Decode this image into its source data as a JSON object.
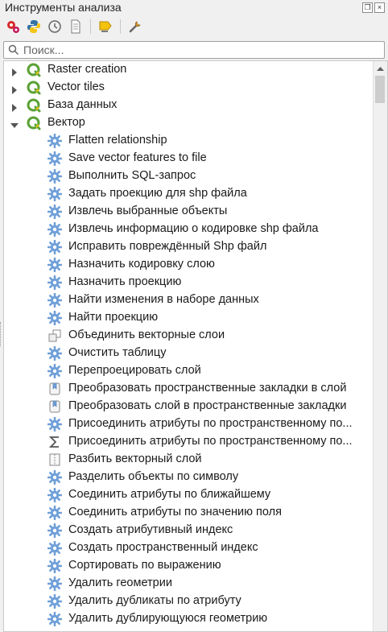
{
  "panel": {
    "title": "Инструменты анализа"
  },
  "toolbar": {
    "buttons": [
      {
        "icon": "models-gear-icon"
      },
      {
        "icon": "python-icon"
      },
      {
        "icon": "history-clock-icon"
      },
      {
        "icon": "results-document-icon"
      },
      {
        "icon": "edit-features-icon"
      },
      {
        "icon": "options-wrench-icon"
      }
    ]
  },
  "search": {
    "placeholder": "Поиск..."
  },
  "tree": {
    "groups": [
      {
        "label": "Raster creation",
        "expanded": false
      },
      {
        "label": "Vector tiles",
        "expanded": false
      },
      {
        "label": "База данных",
        "expanded": false
      },
      {
        "label": "Вектор",
        "expanded": true
      }
    ],
    "items": [
      {
        "label": "Flatten relationship",
        "icon": "gear"
      },
      {
        "label": "Save vector features to file",
        "icon": "gear"
      },
      {
        "label": "Выполнить SQL-запрос",
        "icon": "gear"
      },
      {
        "label": "Задать проекцию для shp файла",
        "icon": "gear"
      },
      {
        "label": "Извлечь выбранные объекты",
        "icon": "gear"
      },
      {
        "label": "Извлечь информацию о кодировке shp файла",
        "icon": "gear"
      },
      {
        "label": "Исправить повреждённый Shp файл",
        "icon": "gear"
      },
      {
        "label": "Назначить кодировку слою",
        "icon": "gear"
      },
      {
        "label": "Назначить проекцию",
        "icon": "gear"
      },
      {
        "label": "Найти изменения в наборе данных",
        "icon": "gear"
      },
      {
        "label": "Найти проекцию",
        "icon": "gear"
      },
      {
        "label": "Объединить векторные слои",
        "icon": "merge"
      },
      {
        "label": "Очистить таблицу",
        "icon": "gear"
      },
      {
        "label": "Перепроецировать слой",
        "icon": "gear"
      },
      {
        "label": "Преобразовать пространственные закладки в слой",
        "icon": "bookmark"
      },
      {
        "label": "Преобразовать слой в пространственные закладки",
        "icon": "bookmark"
      },
      {
        "label": "Присоединить атрибуты по пространственному по...",
        "icon": "gear"
      },
      {
        "label": "Присоединить атрибуты по пространственному по...",
        "icon": "sigma"
      },
      {
        "label": "Разбить векторный слой",
        "icon": "split"
      },
      {
        "label": "Разделить объекты по символу",
        "icon": "gear"
      },
      {
        "label": "Соединить атрибуты по ближайшему",
        "icon": "gear"
      },
      {
        "label": "Соединить атрибуты по значению поля",
        "icon": "gear"
      },
      {
        "label": "Создать атрибутивный индекс",
        "icon": "gear"
      },
      {
        "label": "Создать пространственный индекс",
        "icon": "gear"
      },
      {
        "label": "Сортировать по выражению",
        "icon": "gear"
      },
      {
        "label": "Удалить геометрии",
        "icon": "gear"
      },
      {
        "label": "Удалить дубликаты по атрибуту",
        "icon": "gear"
      },
      {
        "label": "Удалить дублирующуюся геометрию",
        "icon": "gear"
      }
    ]
  },
  "colors": {
    "qgis_green": "#5aa136",
    "gear_blue": "#6f9fd8",
    "arrow": "#555555"
  }
}
